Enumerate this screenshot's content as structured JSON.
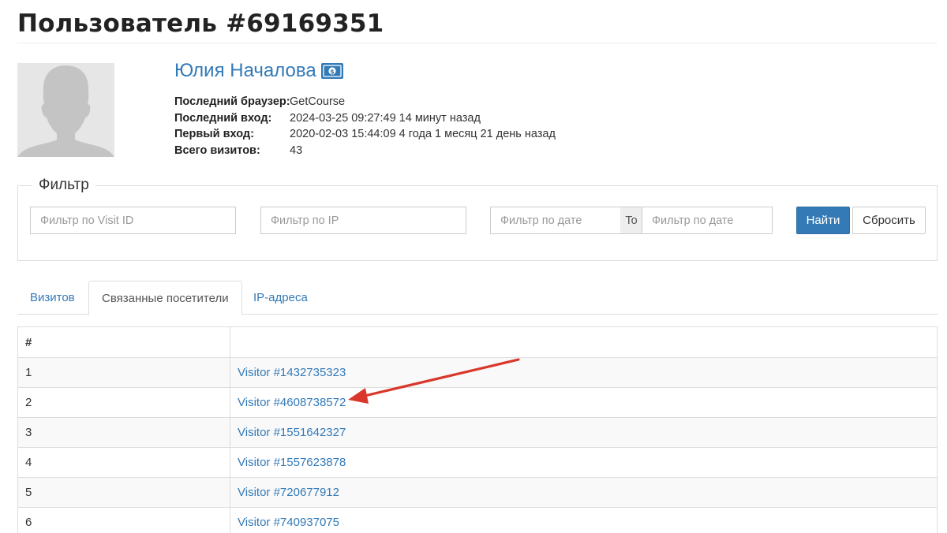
{
  "page": {
    "title": "Пользователь #69169351"
  },
  "user": {
    "name": "Юлия Началова",
    "badge_icon": "money-icon",
    "info": [
      {
        "label": "Последний браузер:",
        "value": "GetCourse"
      },
      {
        "label": "Последний вход:",
        "value": "2024-03-25 09:27:49 14 минут назад"
      },
      {
        "label": "Первый вход:",
        "value": "2020-02-03 15:44:09 4 года 1 месяц 21 день назад"
      },
      {
        "label": "Всего визитов:",
        "value": "43"
      }
    ]
  },
  "filter": {
    "legend": "Фильтр",
    "visit_id_placeholder": "Фильтр по Visit ID",
    "ip_placeholder": "Фильтр по IP",
    "date_from_placeholder": "Фильтр по дате",
    "date_separator": "To",
    "date_to_placeholder": "Фильтр по дате",
    "find_label": "Найти",
    "reset_label": "Сбросить"
  },
  "tabs": [
    {
      "label": "Визитов",
      "active": false
    },
    {
      "label": "Связанные посетители",
      "active": true
    },
    {
      "label": "IP-адреса",
      "active": false
    }
  ],
  "table": {
    "headers": [
      "#",
      ""
    ],
    "rows": [
      {
        "num": "1",
        "visitor": "Visitor #1432735323"
      },
      {
        "num": "2",
        "visitor": "Visitor #4608738572"
      },
      {
        "num": "3",
        "visitor": "Visitor #1551642327"
      },
      {
        "num": "4",
        "visitor": "Visitor #1557623878"
      },
      {
        "num": "5",
        "visitor": "Visitor #720677912"
      },
      {
        "num": "6",
        "visitor": "Visitor #740937075"
      }
    ]
  },
  "colors": {
    "link": "#337ab7",
    "primary_button": "#337ab7",
    "annotation_arrow": "#d9372b"
  }
}
